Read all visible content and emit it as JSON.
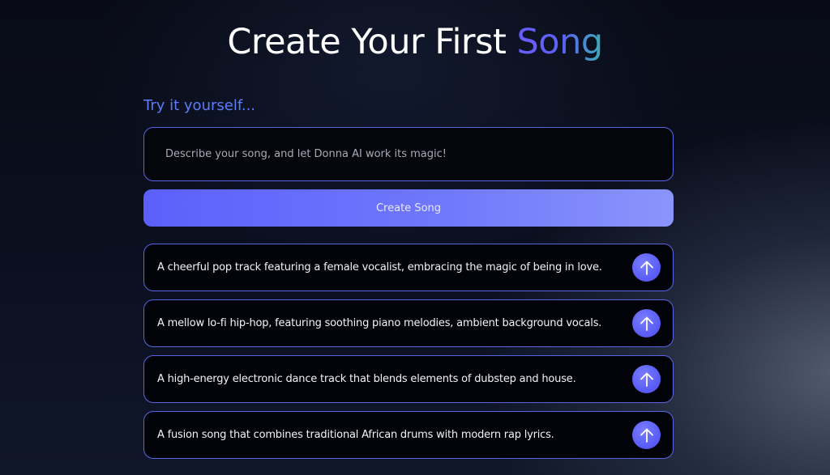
{
  "header": {
    "title_main": "Create Your First ",
    "title_accent": "Song"
  },
  "composer": {
    "try_label": "Try it yourself...",
    "input_value": "",
    "input_placeholder": "Describe your song, and let Donna AI work its magic!",
    "create_button_label": "Create Song"
  },
  "suggestions": [
    {
      "text": "A cheerful pop track featuring a female vocalist, embracing the magic of being in love.",
      "icon": "arrow-up-icon"
    },
    {
      "text": "A mellow lo-fi hip-hop, featuring soothing piano melodies, ambient background vocals.",
      "icon": "arrow-up-icon"
    },
    {
      "text": "A high-energy electronic dance track that blends elements of dubstep and house.",
      "icon": "arrow-up-icon"
    },
    {
      "text": "A fusion song that combines traditional African drums with modern rap lyrics.",
      "icon": "arrow-up-icon"
    }
  ],
  "colors": {
    "accent_blue": "#5c7cfa",
    "button_gradient_start": "#5c60fb",
    "button_gradient_end": "#8b94fb",
    "border": "#5764e6",
    "title_accent_start": "#6a5cff",
    "title_accent_end": "#3ab0b6"
  }
}
